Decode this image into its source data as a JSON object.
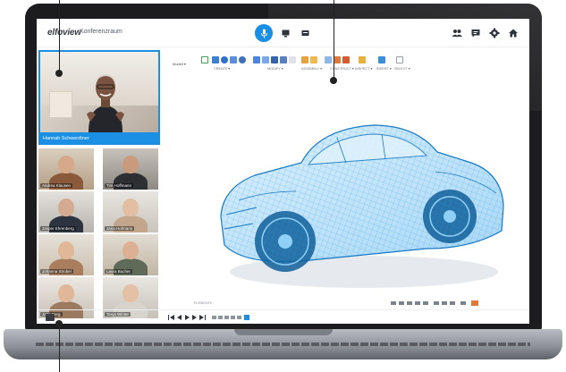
{
  "app": {
    "logo": "elfoview",
    "room": "Konferenzraum"
  },
  "toolbar": {
    "mode_label": "Modell ▾",
    "groups": [
      "CREATE ▾",
      "MODIFY ▾",
      "ASSEMBLY ▾",
      "CONSTRUCT ▾",
      "INSPECT ▾",
      "INSERT ▾",
      "SELECT ▾"
    ]
  },
  "presenter": {
    "name": "Hannah Schwerdtner"
  },
  "participants": [
    {
      "name": "Andrea Klausen"
    },
    {
      "name": "Tim Hoffmann"
    },
    {
      "name": "Jasper Ehrenberg"
    },
    {
      "name": "Jana Hofmann"
    },
    {
      "name": "Johanna Strobel"
    },
    {
      "name": "Laura Bucher"
    },
    {
      "name": "Jana Berg"
    },
    {
      "name": "Tanja Winter"
    }
  ],
  "viewer": {
    "status": "ELEMENTE"
  },
  "colors": {
    "accent": "#1a8fe3",
    "wireframe": "#2a9fe6",
    "laptop": "#1c1c1e"
  },
  "icons": {
    "mic": "microphone-icon",
    "screen": "screen-share-icon",
    "chat": "chat-icon",
    "people": "participants-icon",
    "settings": "gear-icon",
    "home": "home-icon"
  }
}
